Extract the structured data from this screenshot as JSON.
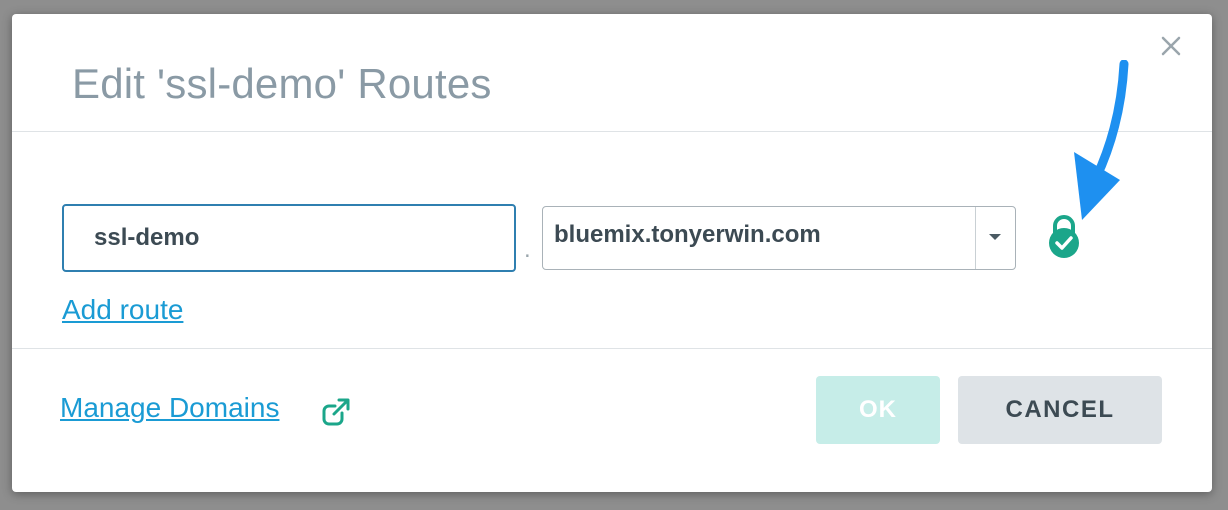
{
  "dialog": {
    "title": "Edit 'ssl-demo' Routes",
    "close_icon": "close-icon"
  },
  "route": {
    "host_value": "ssl-demo",
    "separator": ".",
    "domain_value": "bluemix.tonyerwin.com",
    "dropdown_icon": "chevron-down-icon",
    "ssl_status_icon": "lock-check-icon"
  },
  "links": {
    "add_route": "Add route",
    "manage_domains": "Manage Domains",
    "external_icon": "external-link-icon"
  },
  "buttons": {
    "ok": "OK",
    "cancel": "CANCEL"
  },
  "colors": {
    "accent_link": "#1a9bd4",
    "ssl_green": "#1ba68a",
    "ok_disabled_bg": "#c6ede8",
    "cancel_bg": "#dee3e7",
    "annotation_arrow": "#1e90f0"
  }
}
